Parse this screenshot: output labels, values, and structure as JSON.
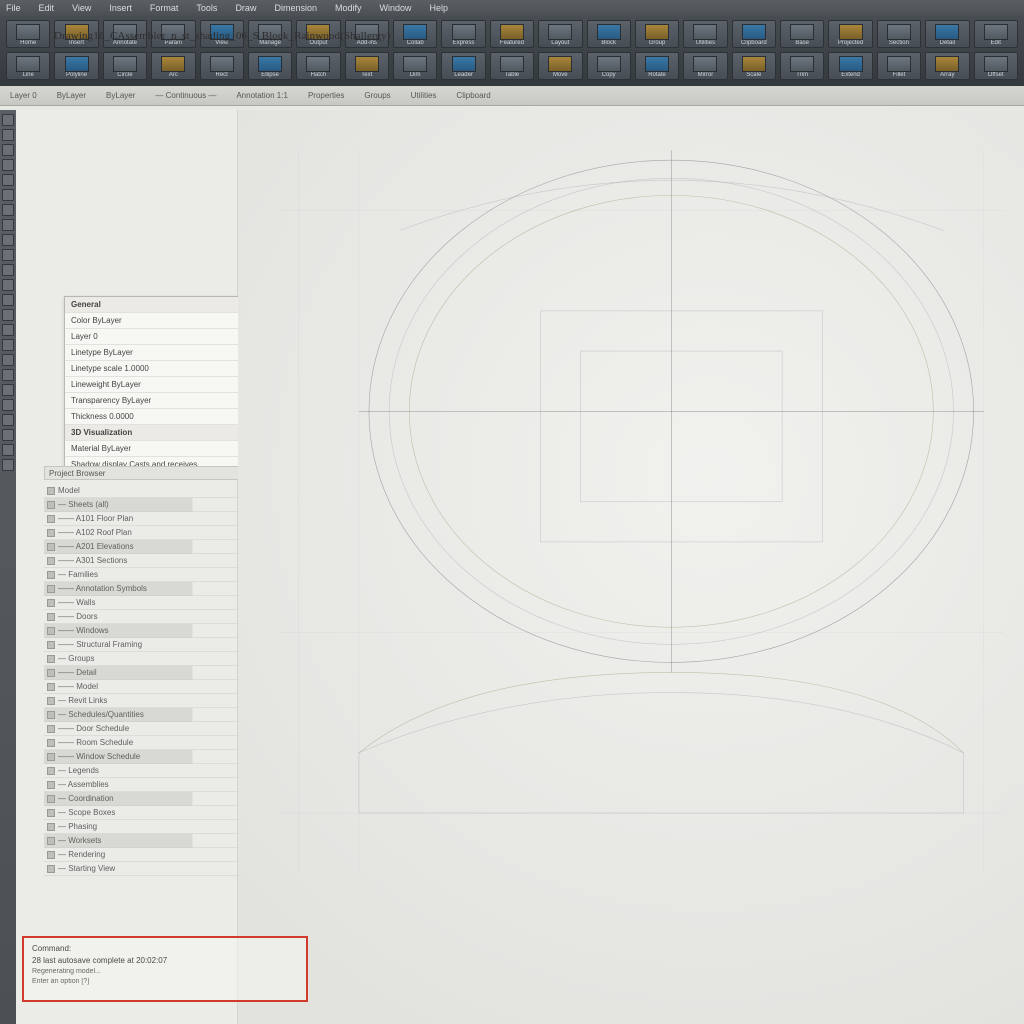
{
  "app": {
    "menus": [
      "File",
      "Edit",
      "View",
      "Insert",
      "Format",
      "Tools",
      "Draw",
      "Dimension",
      "Modify",
      "Window",
      "Help"
    ],
    "doc_title": "Drawing16_CAssembler_n_st_shading_06_S Block_Rainwood(Shallergy)"
  },
  "ribbon": {
    "row1": [
      {
        "l": "Home"
      },
      {
        "l": "Insert",
        "warm": true
      },
      {
        "l": "Annotate"
      },
      {
        "l": "Param"
      },
      {
        "l": "View",
        "accent": true
      },
      {
        "l": "Manage"
      },
      {
        "l": "Output",
        "warm": true
      },
      {
        "l": "Add-ins"
      },
      {
        "l": "Collab",
        "accent": true
      },
      {
        "l": "Express"
      },
      {
        "l": "Featured",
        "warm": true
      },
      {
        "l": "Layout"
      },
      {
        "l": "Block",
        "accent": true
      },
      {
        "l": "Group",
        "warm": true
      },
      {
        "l": "Utilities"
      },
      {
        "l": "Clipboard",
        "accent": true
      },
      {
        "l": "Base"
      },
      {
        "l": "Projected",
        "warm": true
      },
      {
        "l": "Section"
      },
      {
        "l": "Detail",
        "accent": true
      },
      {
        "l": "Edit"
      }
    ],
    "row2": [
      {
        "l": "Line"
      },
      {
        "l": "Polyline",
        "accent": true
      },
      {
        "l": "Circle"
      },
      {
        "l": "Arc",
        "warm": true
      },
      {
        "l": "Rect"
      },
      {
        "l": "Ellipse",
        "accent": true
      },
      {
        "l": "Hatch"
      },
      {
        "l": "Text",
        "warm": true
      },
      {
        "l": "Dim"
      },
      {
        "l": "Leader",
        "accent": true
      },
      {
        "l": "Table"
      },
      {
        "l": "Move",
        "warm": true
      },
      {
        "l": "Copy"
      },
      {
        "l": "Rotate",
        "accent": true
      },
      {
        "l": "Mirror"
      },
      {
        "l": "Scale",
        "warm": true
      },
      {
        "l": "Trim"
      },
      {
        "l": "Extend",
        "accent": true
      },
      {
        "l": "Fillet"
      },
      {
        "l": "Array",
        "warm": true
      },
      {
        "l": "Offset"
      }
    ]
  },
  "optbar": [
    "Layer 0",
    "ByLayer",
    "ByLayer",
    "— Continuous —",
    "Annotation 1:1",
    "Properties",
    "Groups",
    "Utilities",
    "Clipboard"
  ],
  "tools_count": 24,
  "panel": {
    "rows": [
      {
        "t": "General",
        "head": true
      },
      {
        "t": "Color                ByLayer"
      },
      {
        "t": "Layer                0"
      },
      {
        "t": "Linetype           ByLayer"
      },
      {
        "t": "Linetype scale   1.0000"
      },
      {
        "t": "Lineweight        ByLayer"
      },
      {
        "t": "Transparency    ByLayer"
      },
      {
        "t": "Thickness          0.0000"
      },
      {
        "t": "3D Visualization",
        "head": true
      },
      {
        "t": "Material            ByLayer"
      },
      {
        "t": "Shadow display  Casts and receives"
      }
    ]
  },
  "browser": {
    "header": "Project Browser",
    "nodes": [
      "Model",
      "— Sheets (all)",
      "—— A101 Floor Plan",
      "—— A102 Roof Plan",
      "—— A201 Elevations",
      "—— A301 Sections",
      "— Families",
      "—— Annotation Symbols",
      "—— Walls",
      "—— Doors",
      "—— Windows",
      "—— Structural Framing",
      "— Groups",
      "—— Detail",
      "—— Model",
      "— Revit Links",
      "— Schedules/Quantities",
      "—— Door Schedule",
      "—— Room Schedule",
      "—— Window Schedule",
      "— Legends",
      "— Assemblies",
      "— Coordination",
      "— Scope Boxes",
      "— Phasing",
      "— Worksets",
      "— Rendering",
      "— Starting View"
    ]
  },
  "cmdbox": {
    "lines": [
      "Command:",
      "28   last autosave complete at 20:02:07",
      "Regenerating model...",
      "Enter an option [?]"
    ]
  }
}
